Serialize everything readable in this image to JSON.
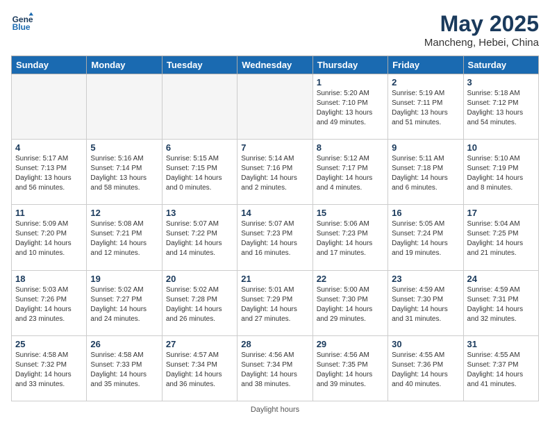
{
  "header": {
    "logo_line1": "General",
    "logo_line2": "Blue",
    "month": "May 2025",
    "location": "Mancheng, Hebei, China"
  },
  "days_of_week": [
    "Sunday",
    "Monday",
    "Tuesday",
    "Wednesday",
    "Thursday",
    "Friday",
    "Saturday"
  ],
  "weeks": [
    [
      {
        "day": "",
        "info": ""
      },
      {
        "day": "",
        "info": ""
      },
      {
        "day": "",
        "info": ""
      },
      {
        "day": "",
        "info": ""
      },
      {
        "day": "1",
        "info": "Sunrise: 5:20 AM\nSunset: 7:10 PM\nDaylight: 13 hours\nand 49 minutes."
      },
      {
        "day": "2",
        "info": "Sunrise: 5:19 AM\nSunset: 7:11 PM\nDaylight: 13 hours\nand 51 minutes."
      },
      {
        "day": "3",
        "info": "Sunrise: 5:18 AM\nSunset: 7:12 PM\nDaylight: 13 hours\nand 54 minutes."
      }
    ],
    [
      {
        "day": "4",
        "info": "Sunrise: 5:17 AM\nSunset: 7:13 PM\nDaylight: 13 hours\nand 56 minutes."
      },
      {
        "day": "5",
        "info": "Sunrise: 5:16 AM\nSunset: 7:14 PM\nDaylight: 13 hours\nand 58 minutes."
      },
      {
        "day": "6",
        "info": "Sunrise: 5:15 AM\nSunset: 7:15 PM\nDaylight: 14 hours\nand 0 minutes."
      },
      {
        "day": "7",
        "info": "Sunrise: 5:14 AM\nSunset: 7:16 PM\nDaylight: 14 hours\nand 2 minutes."
      },
      {
        "day": "8",
        "info": "Sunrise: 5:12 AM\nSunset: 7:17 PM\nDaylight: 14 hours\nand 4 minutes."
      },
      {
        "day": "9",
        "info": "Sunrise: 5:11 AM\nSunset: 7:18 PM\nDaylight: 14 hours\nand 6 minutes."
      },
      {
        "day": "10",
        "info": "Sunrise: 5:10 AM\nSunset: 7:19 PM\nDaylight: 14 hours\nand 8 minutes."
      }
    ],
    [
      {
        "day": "11",
        "info": "Sunrise: 5:09 AM\nSunset: 7:20 PM\nDaylight: 14 hours\nand 10 minutes."
      },
      {
        "day": "12",
        "info": "Sunrise: 5:08 AM\nSunset: 7:21 PM\nDaylight: 14 hours\nand 12 minutes."
      },
      {
        "day": "13",
        "info": "Sunrise: 5:07 AM\nSunset: 7:22 PM\nDaylight: 14 hours\nand 14 minutes."
      },
      {
        "day": "14",
        "info": "Sunrise: 5:07 AM\nSunset: 7:23 PM\nDaylight: 14 hours\nand 16 minutes."
      },
      {
        "day": "15",
        "info": "Sunrise: 5:06 AM\nSunset: 7:23 PM\nDaylight: 14 hours\nand 17 minutes."
      },
      {
        "day": "16",
        "info": "Sunrise: 5:05 AM\nSunset: 7:24 PM\nDaylight: 14 hours\nand 19 minutes."
      },
      {
        "day": "17",
        "info": "Sunrise: 5:04 AM\nSunset: 7:25 PM\nDaylight: 14 hours\nand 21 minutes."
      }
    ],
    [
      {
        "day": "18",
        "info": "Sunrise: 5:03 AM\nSunset: 7:26 PM\nDaylight: 14 hours\nand 23 minutes."
      },
      {
        "day": "19",
        "info": "Sunrise: 5:02 AM\nSunset: 7:27 PM\nDaylight: 14 hours\nand 24 minutes."
      },
      {
        "day": "20",
        "info": "Sunrise: 5:02 AM\nSunset: 7:28 PM\nDaylight: 14 hours\nand 26 minutes."
      },
      {
        "day": "21",
        "info": "Sunrise: 5:01 AM\nSunset: 7:29 PM\nDaylight: 14 hours\nand 27 minutes."
      },
      {
        "day": "22",
        "info": "Sunrise: 5:00 AM\nSunset: 7:30 PM\nDaylight: 14 hours\nand 29 minutes."
      },
      {
        "day": "23",
        "info": "Sunrise: 4:59 AM\nSunset: 7:30 PM\nDaylight: 14 hours\nand 31 minutes."
      },
      {
        "day": "24",
        "info": "Sunrise: 4:59 AM\nSunset: 7:31 PM\nDaylight: 14 hours\nand 32 minutes."
      }
    ],
    [
      {
        "day": "25",
        "info": "Sunrise: 4:58 AM\nSunset: 7:32 PM\nDaylight: 14 hours\nand 33 minutes."
      },
      {
        "day": "26",
        "info": "Sunrise: 4:58 AM\nSunset: 7:33 PM\nDaylight: 14 hours\nand 35 minutes."
      },
      {
        "day": "27",
        "info": "Sunrise: 4:57 AM\nSunset: 7:34 PM\nDaylight: 14 hours\nand 36 minutes."
      },
      {
        "day": "28",
        "info": "Sunrise: 4:56 AM\nSunset: 7:34 PM\nDaylight: 14 hours\nand 38 minutes."
      },
      {
        "day": "29",
        "info": "Sunrise: 4:56 AM\nSunset: 7:35 PM\nDaylight: 14 hours\nand 39 minutes."
      },
      {
        "day": "30",
        "info": "Sunrise: 4:55 AM\nSunset: 7:36 PM\nDaylight: 14 hours\nand 40 minutes."
      },
      {
        "day": "31",
        "info": "Sunrise: 4:55 AM\nSunset: 7:37 PM\nDaylight: 14 hours\nand 41 minutes."
      }
    ]
  ],
  "footer": "Daylight hours"
}
